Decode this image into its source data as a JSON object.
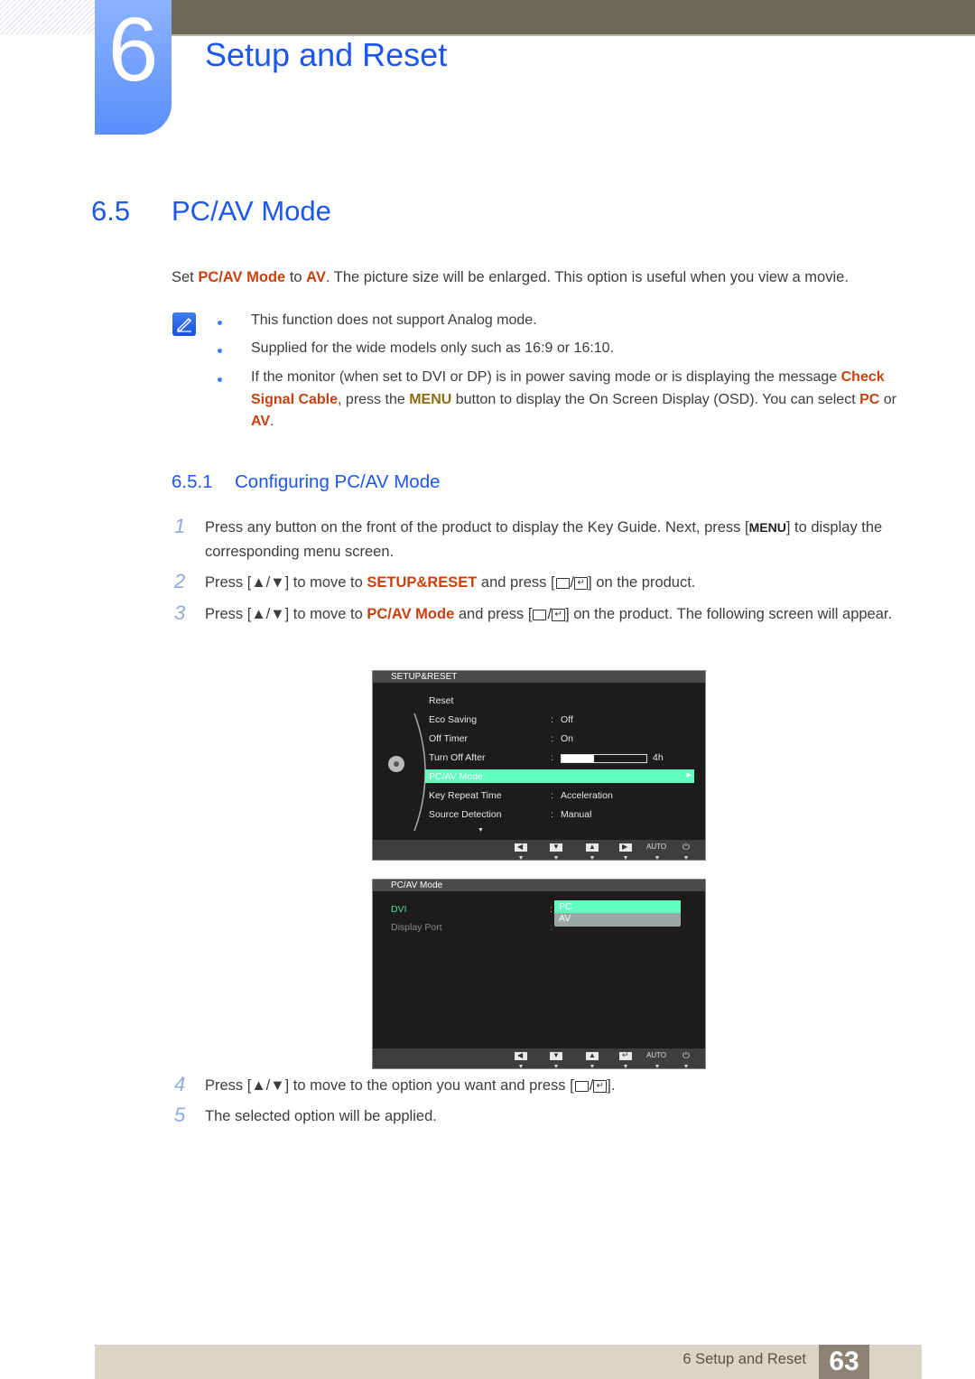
{
  "header": {
    "chapter_number": "6",
    "chapter_title": "Setup and Reset"
  },
  "section": {
    "number": "6.5",
    "title": "PC/AV Mode",
    "intro": {
      "t1": "Set ",
      "h1": "PC/AV Mode",
      "t2": " to ",
      "h2": "AV",
      "t3": ". The picture size will be enlarged. This option is useful when you view a movie."
    },
    "notes": [
      {
        "text": "This function does not support Analog mode."
      },
      {
        "text": "Supplied for the wide models only such as 16:9 or 16:10."
      },
      {
        "t1": "If the monitor (when set to DVI or DP) is in power saving mode or is displaying the message ",
        "h1": "Check Signal Cable",
        "t2": ", press the ",
        "h2": "MENU",
        "t3": " button to display the On Screen Display (OSD). You can select ",
        "h3": "PC",
        "t4": " or ",
        "h4": "AV",
        "t5": "."
      }
    ]
  },
  "subsection": {
    "number": "6.5.1",
    "title": "Configuring PC/AV Mode",
    "steps": [
      {
        "num": "1",
        "t1": "Press any button on the front of the product to display the Key Guide. Next, press [",
        "key": "MENU",
        "t2": "] to display the corresponding menu screen."
      },
      {
        "num": "2",
        "t1": "Press [▲/▼] to move to ",
        "h": "SETUP&RESET",
        "t2": " and press [",
        "t3": "] on the product."
      },
      {
        "num": "3",
        "t1": "Press [▲/▼] to move to ",
        "h": "PC/AV Mode",
        "t2": " and press [",
        "t3": "] on the product. The following screen will appear."
      },
      {
        "num": "4",
        "t1": "Press [▲/▼] to move to the option you want and press [",
        "t3": "]."
      },
      {
        "num": "5",
        "t1": "The selected option will be applied."
      }
    ]
  },
  "osd1": {
    "title": "SETUP&RESET",
    "items": [
      {
        "label": "Reset",
        "value": ""
      },
      {
        "label": "Eco Saving",
        "value": "Off"
      },
      {
        "label": "Off Timer",
        "value": "On"
      },
      {
        "label": "Turn Off After",
        "value": "4h",
        "progress": 0.38
      },
      {
        "label": "PC/AV Mode",
        "value": "",
        "selected": true
      },
      {
        "label": "Key Repeat Time",
        "value": "Acceleration"
      },
      {
        "label": "Source Detection",
        "value": "Manual"
      }
    ],
    "footer_keys": [
      "left",
      "down",
      "up",
      "right",
      "AUTO",
      "power"
    ]
  },
  "osd2": {
    "title": "PC/AV Mode",
    "items": [
      {
        "label": "DVI",
        "active": true
      },
      {
        "label": "Display Port",
        "active": false
      }
    ],
    "options": [
      "PC",
      "AV"
    ],
    "selected_option": "PC",
    "footer_keys": [
      "left",
      "down",
      "up",
      "enter",
      "AUTO",
      "power"
    ]
  },
  "colors": {
    "accent_blue": "#1b57ef",
    "highlight_orange": "#c8410f",
    "osd_select_green": "#5fffc0"
  },
  "footer": {
    "text": "6 Setup and Reset",
    "page": "63"
  }
}
